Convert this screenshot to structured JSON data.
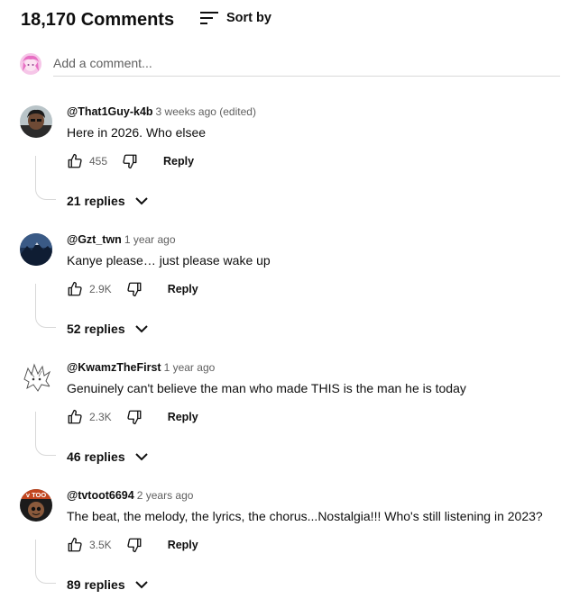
{
  "header": {
    "comment_count": "18,170 Comments",
    "sort_label": "Sort by",
    "sort_icon": "sort-lines-icon"
  },
  "add_comment": {
    "placeholder": "Add a comment..."
  },
  "comments": [
    {
      "author": "@That1Guy-k4b",
      "time": "3 weeks ago (edited)",
      "text": "Here in 2026. Who elsee",
      "likes": "455",
      "reply_label": "Reply",
      "replies_label": "21 replies"
    },
    {
      "author": "@Gzt_twn",
      "time": "1 year ago",
      "text": "Kanye please… just please wake up",
      "likes": "2.9K",
      "reply_label": "Reply",
      "replies_label": "52 replies"
    },
    {
      "author": "@KwamzTheFirst",
      "time": "1 year ago",
      "text": "Genuinely can't believe the man who made THIS is the man he is today",
      "likes": "2.3K",
      "reply_label": "Reply",
      "replies_label": "46 replies"
    },
    {
      "author": "@tvtoot6694",
      "time": "2 years ago",
      "text": "The beat, the melody, the lyrics,  the chorus...Nostalgia!!! Who's still listening in 2023?",
      "likes": "3.5K",
      "reply_label": "Reply",
      "replies_label": "89 replies",
      "avatar_text": "v TOO"
    }
  ]
}
